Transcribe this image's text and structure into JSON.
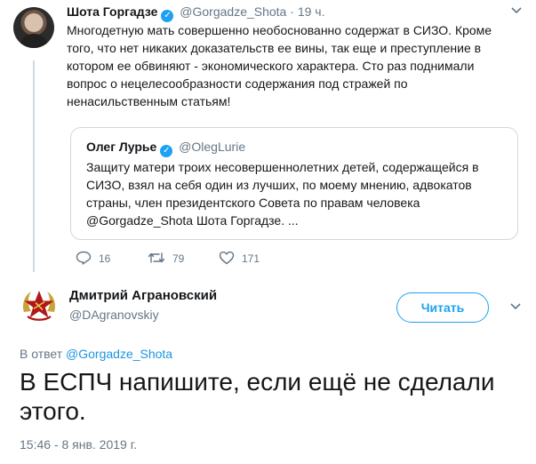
{
  "tweet1": {
    "name": "Шота Горгадзе",
    "handle": "@Gorgadze_Shota",
    "sep": "·",
    "time": "19 ч.",
    "text": "Многодетную мать совершенно необоснованно содержат в СИЗО. Кроме того, что нет никаких доказательств ее вины, так еще и преступление в котором ее обвиняют - экономического характера. Сто раз поднимали вопрос о нецелесообразности содержания под стражей по ненасильственным статьям!",
    "quote": {
      "name": "Олег Лурье",
      "handle": "@OlegLurie",
      "text": "Защиту матери троих несовершеннолетних детей, содержащейся в СИЗО, взял на себя один из лучших, по моему мнению, адвокатов страны, член президентского Совета по правам человека @Gorgadze_Shota Шота Горгадзе.  ..."
    },
    "actions": {
      "replies": "16",
      "retweets": "79",
      "likes": "171"
    }
  },
  "tweet2": {
    "name": "Дмитрий Аграновский",
    "handle": "@DAgranovskiy",
    "follow_label": "Читать",
    "reply_prefix": "В ответ",
    "reply_handle": "@Gorgadze_Shota",
    "text": "В ЕСПЧ напишите, если ещё не сделали этого.",
    "timestamp": "15:46 - 8 янв. 2019 г."
  },
  "icons": {
    "verified": "verified-badge-icon",
    "caret": "chevron-down-icon",
    "reply": "reply-icon",
    "retweet": "retweet-icon",
    "like": "heart-icon"
  },
  "colors": {
    "accent": "#1da1f2",
    "muted": "#657786",
    "text": "#14171a",
    "line": "#cfd9de",
    "emblem": "#b01818"
  }
}
